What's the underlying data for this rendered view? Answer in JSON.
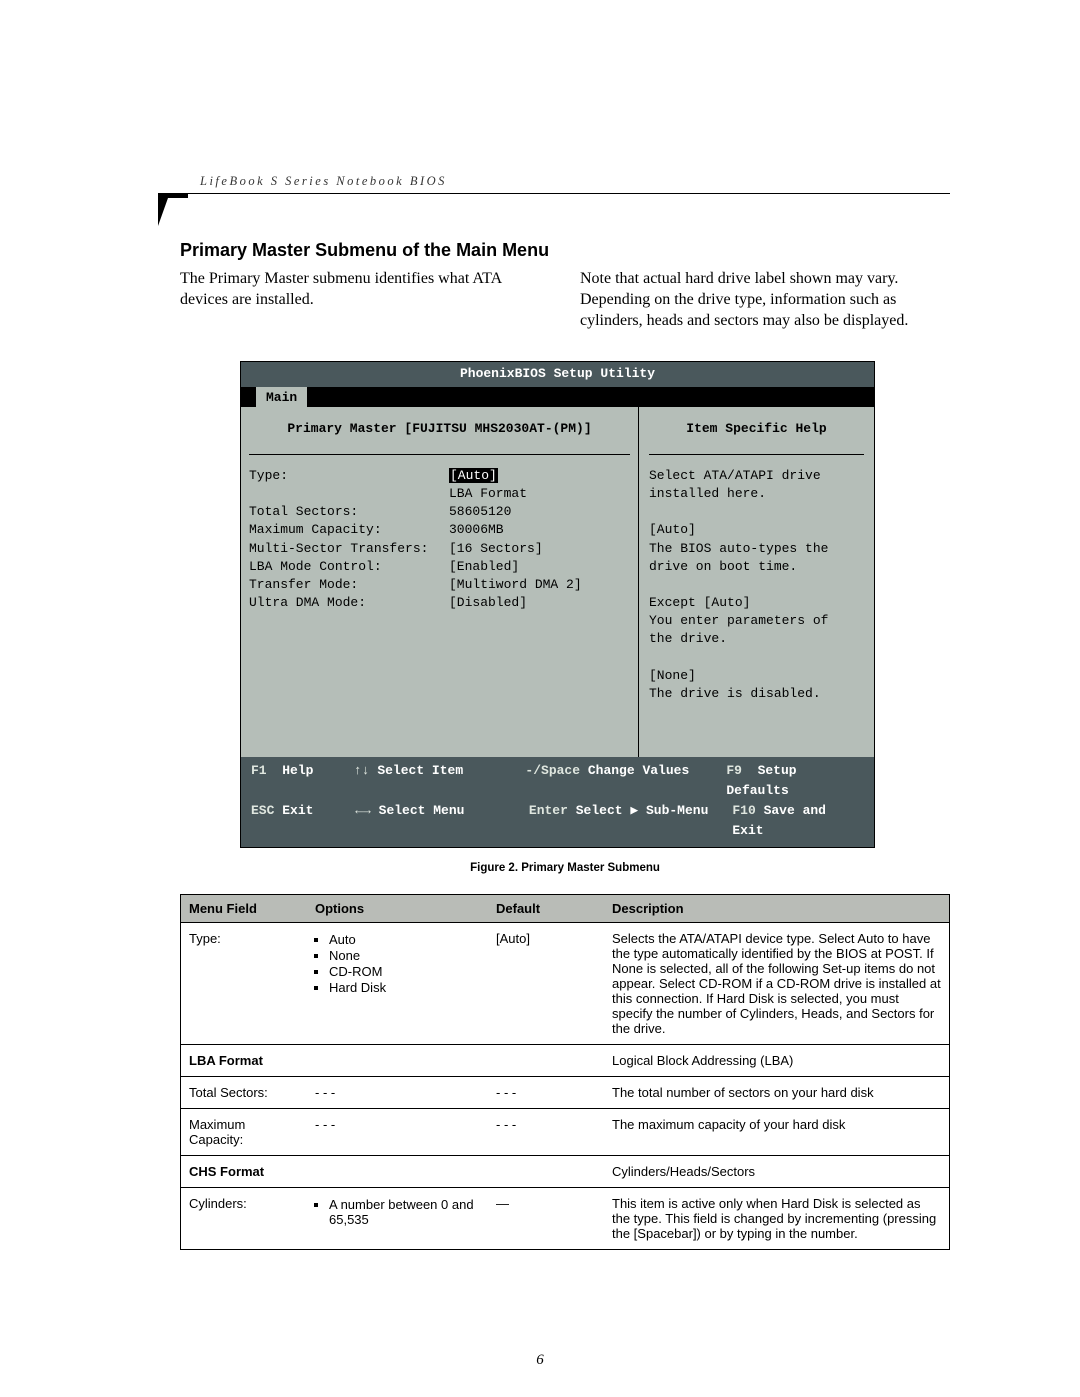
{
  "header": "LifeBook S Series Notebook BIOS",
  "section_title": "Primary Master Submenu of the Main Menu",
  "intro_left": "The Primary Master submenu identifies what ATA devices are installed.",
  "intro_right": "Note that actual hard drive label shown may vary. Depending on the drive type, information such as cylinders, heads and sectors may also be displayed.",
  "bios": {
    "title": "PhoenixBIOS Setup Utility",
    "active_tab": "Main",
    "panel_title": "Primary Master [FUJITSU MHS2030AT-(PM)]",
    "help_title": "Item Specific Help",
    "fields": [
      {
        "label": "Type:",
        "value": "[Auto]",
        "selected": true
      },
      {
        "label": "",
        "value": "LBA Format"
      },
      {
        "label": "Total Sectors:",
        "value": "58605120"
      },
      {
        "label": "Maximum Capacity:",
        "value": "30006MB"
      },
      {
        "label": "",
        "value": ""
      },
      {
        "label": "Multi-Sector Transfers:",
        "value": "[16 Sectors]"
      },
      {
        "label": "LBA Mode Control:",
        "value": "[Enabled]"
      },
      {
        "label": "Transfer Mode:",
        "value": "[Multiword DMA 2]"
      },
      {
        "label": "Ultra DMA Mode:",
        "value": "[Disabled]"
      }
    ],
    "help_lines": [
      "Select ATA/ATAPI drive",
      "installed here.",
      "",
      "[Auto]",
      "The BIOS auto-types the",
      "drive on boot time.",
      "",
      "Except [Auto]",
      "You enter parameters of",
      "the drive.",
      "",
      "[None]",
      "The drive is disabled."
    ],
    "footer": {
      "r1": {
        "k1": "F1",
        "a1": "Help",
        "k2": "↑↓",
        "a2": "Select Item",
        "k3": "-/Space",
        "a3": "Change Values",
        "k4": "F9",
        "a4": "Setup Defaults"
      },
      "r2": {
        "k1": "ESC",
        "a1": "Exit",
        "k2": "←→",
        "a2": "Select Menu",
        "k3": "Enter",
        "a3": "Select ▶ Sub-Menu",
        "k4": "F10",
        "a4": "Save and Exit"
      }
    }
  },
  "figure_caption": "Figure 2.  Primary Master Submenu",
  "table": {
    "headers": [
      "Menu Field",
      "Options",
      "Default",
      "Description"
    ],
    "rows": [
      {
        "menu": "Type:",
        "options": [
          "Auto",
          "None",
          "CD-ROM",
          "Hard Disk"
        ],
        "default": "[Auto]",
        "desc": "Selects the ATA/ATAPI device type. Select Auto to have the type automatically identified by the BIOS at POST. If None is selected, all of the following Set-up items do not appear. Select CD-ROM if a CD-ROM drive is installed at this connection. If Hard Disk is selected, you must specify the number of Cylinders, Heads, and Sectors for the drive."
      },
      {
        "subheader": true,
        "menu": "LBA Format",
        "desc": "Logical Block Addressing (LBA)"
      },
      {
        "menu": "Total Sectors:",
        "options_text": "- - -",
        "default": "- - -",
        "desc": "The total number of sectors on your hard disk"
      },
      {
        "menu": "Maximum Capacity:",
        "options_text": "- - -",
        "default": "- - -",
        "desc": "The maximum capacity of your hard disk"
      },
      {
        "subheader": true,
        "menu": "CHS Format",
        "desc": "Cylinders/Heads/Sectors"
      },
      {
        "menu": "Cylinders:",
        "options": [
          "A number between 0 and 65,535"
        ],
        "default": "—",
        "desc": "This item is active only when Hard Disk is selected as the type. This field is changed by incrementing (pressing the [Spacebar]) or by typing in the number."
      }
    ]
  },
  "page_number": "6"
}
